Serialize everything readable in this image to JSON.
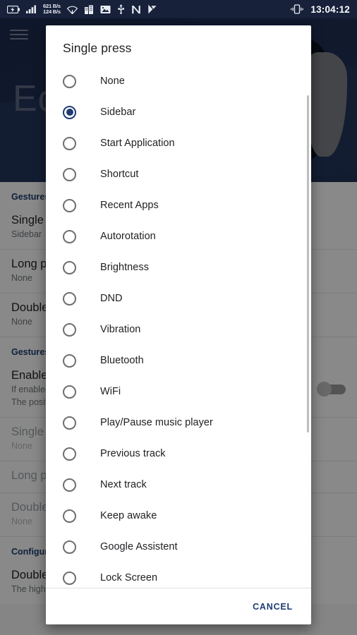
{
  "statusbar": {
    "icons_left": [
      "battery-charging-icon",
      "signal-bars-icon",
      "wifi-icon",
      "building-icon",
      "image-icon",
      "usb-icon",
      "nova-launcher-icon",
      "checkmark-flag-icon"
    ],
    "data_rate_down": "621 B/s",
    "data_rate_up": "124 B/s",
    "vibrate_icon": "vibration-icon",
    "clock": "13:04:12"
  },
  "app": {
    "menu_icon": "hamburger-menu-icon",
    "title": "Ed",
    "sections": [
      {
        "header": "Gestures",
        "rows": [
          {
            "title": "Single pr",
            "sub": "Sidebar",
            "dim": false
          },
          {
            "title": "Long pre",
            "sub": "None",
            "dim": false
          },
          {
            "title": "Double p",
            "sub": "None",
            "dim": false
          }
        ]
      },
      {
        "header": "Gestures i",
        "rows": [
          {
            "title": "Enable G",
            "sub": "If enabled,",
            "sub2": "The positi",
            "dim": false,
            "toggle": true
          },
          {
            "title": "Single pr",
            "sub": "None",
            "dim": true
          },
          {
            "title": "Long pre",
            "sub": "",
            "dim": true
          },
          {
            "title": "Double p",
            "sub": "None",
            "dim": true
          }
        ]
      },
      {
        "header": "Configurat",
        "rows": [
          {
            "title": "Double p",
            "sub": "The higher",
            "dim": false
          }
        ]
      }
    ]
  },
  "dialog": {
    "title": "Single press",
    "selected": "Sidebar",
    "options": [
      "None",
      "Sidebar",
      "Start Application",
      "Shortcut",
      "Recent Apps",
      "Autorotation",
      "Brightness",
      "DND",
      "Vibration",
      "Bluetooth",
      "WiFi",
      "Play/Pause music player",
      "Previous track",
      "Next track",
      "Keep awake",
      "Google Assistent",
      "Lock Screen"
    ],
    "cancel_label": "CANCEL"
  },
  "colors": {
    "accent": "#1d3b74",
    "appbar": "#1e2d52",
    "statusbar": "#17213a"
  }
}
